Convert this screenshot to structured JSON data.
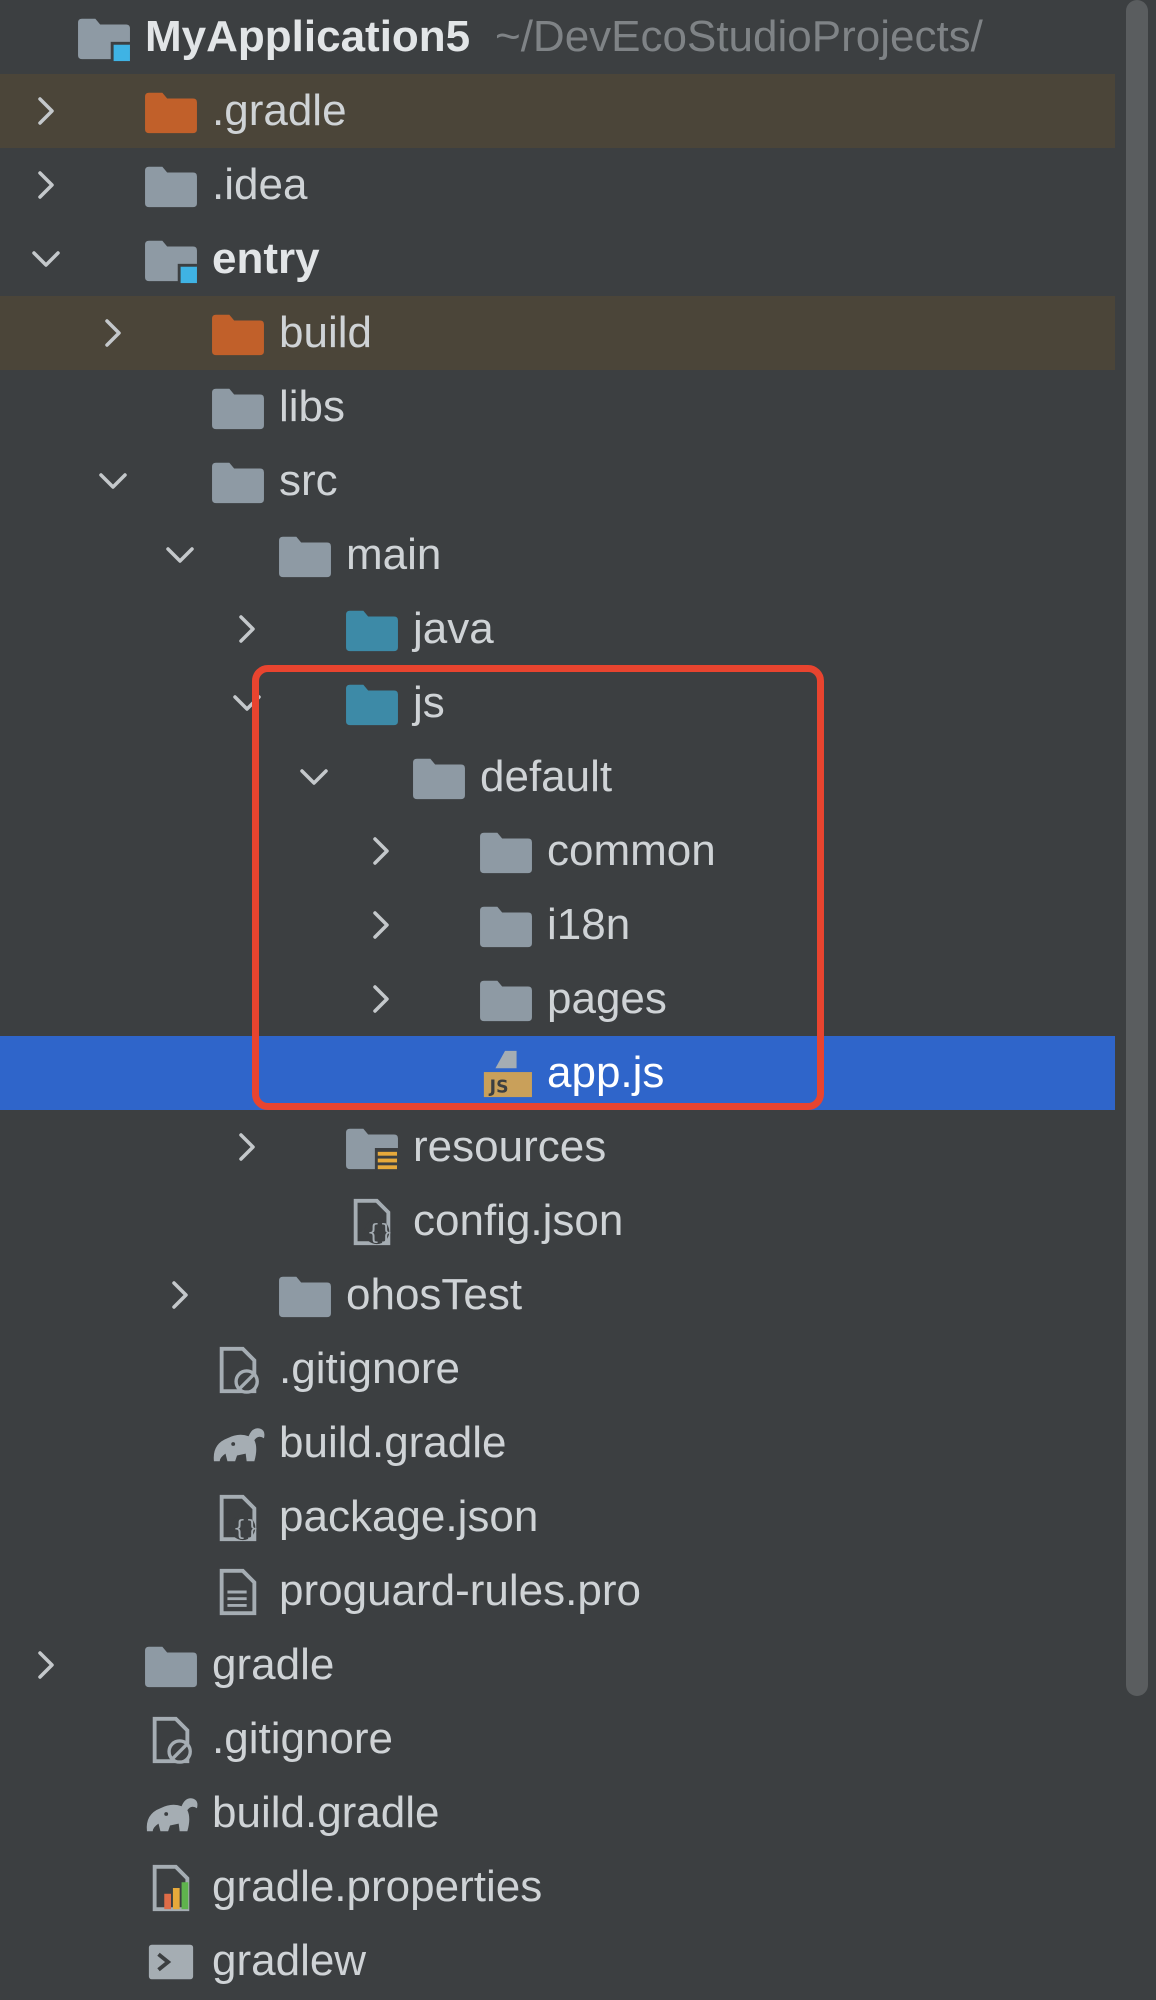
{
  "tree": {
    "items": [
      {
        "name": "myapplication5",
        "label": "MyApplication5",
        "hint": "~/DevEcoStudioProjects/",
        "icon": "module-folder-icon",
        "depth": 0,
        "expanded": true,
        "bold": true
      },
      {
        "name": "gradle-dot",
        "label": ".gradle",
        "icon": "excluded-folder-icon",
        "depth": 1,
        "expanded": false,
        "excluded": true
      },
      {
        "name": "idea",
        "label": ".idea",
        "icon": "folder-icon",
        "depth": 1,
        "expanded": false
      },
      {
        "name": "entry",
        "label": "entry",
        "icon": "module-folder-icon",
        "depth": 1,
        "expanded": true,
        "bold": true
      },
      {
        "name": "build",
        "label": "build",
        "icon": "excluded-folder-icon",
        "depth": 2,
        "expanded": false,
        "excluded": true
      },
      {
        "name": "libs",
        "label": "libs",
        "icon": "folder-icon",
        "depth": 2
      },
      {
        "name": "src",
        "label": "src",
        "icon": "folder-icon",
        "depth": 2,
        "expanded": true
      },
      {
        "name": "main",
        "label": "main",
        "icon": "folder-icon",
        "depth": 3,
        "expanded": true
      },
      {
        "name": "java",
        "label": "java",
        "icon": "source-folder-icon",
        "depth": 4,
        "expanded": false
      },
      {
        "name": "js",
        "label": "js",
        "icon": "source-folder-icon",
        "depth": 4,
        "expanded": true
      },
      {
        "name": "default",
        "label": "default",
        "icon": "folder-icon",
        "depth": 5,
        "expanded": true
      },
      {
        "name": "common",
        "label": "common",
        "icon": "folder-icon",
        "depth": 6,
        "expanded": false
      },
      {
        "name": "i18n",
        "label": "i18n",
        "icon": "folder-icon",
        "depth": 6,
        "expanded": false
      },
      {
        "name": "pages",
        "label": "pages",
        "icon": "folder-icon",
        "depth": 6,
        "expanded": false
      },
      {
        "name": "app-js",
        "label": "app.js",
        "icon": "js-file-icon",
        "depth": 6,
        "selected": true
      },
      {
        "name": "resources",
        "label": "resources",
        "icon": "resources-folder-icon",
        "depth": 4,
        "expanded": false
      },
      {
        "name": "config-json",
        "label": "config.json",
        "icon": "json-file-icon",
        "depth": 4
      },
      {
        "name": "ohostest",
        "label": "ohosTest",
        "icon": "folder-icon",
        "depth": 3,
        "expanded": false
      },
      {
        "name": "entry-gitignore",
        "label": ".gitignore",
        "icon": "gitignore-file-icon",
        "depth": 2
      },
      {
        "name": "entry-build-gradle",
        "label": "build.gradle",
        "icon": "gradle-elephant-icon",
        "depth": 2
      },
      {
        "name": "package-json",
        "label": "package.json",
        "icon": "json-file-icon",
        "depth": 2
      },
      {
        "name": "proguard-rules",
        "label": "proguard-rules.pro",
        "icon": "text-file-icon",
        "depth": 2
      },
      {
        "name": "gradle",
        "label": "gradle",
        "icon": "folder-icon",
        "depth": 1,
        "expanded": false
      },
      {
        "name": "root-gitignore",
        "label": ".gitignore",
        "icon": "gitignore-file-icon",
        "depth": 1
      },
      {
        "name": "root-build-gradle",
        "label": "build.gradle",
        "icon": "gradle-elephant-icon",
        "depth": 1
      },
      {
        "name": "gradle-properties",
        "label": "gradle.properties",
        "icon": "properties-file-icon",
        "depth": 1
      },
      {
        "name": "gradlew",
        "label": "gradlew",
        "icon": "shell-script-icon",
        "depth": 1
      }
    ]
  },
  "colors": {
    "background": "#3c3f41",
    "selection": "#2f65ca",
    "excluded_row": "#4b4539",
    "highlight_border": "#e8442f",
    "folder": "#8e9aa4",
    "source_folder": "#3d8aa7",
    "excluded_folder": "#c1602a"
  }
}
